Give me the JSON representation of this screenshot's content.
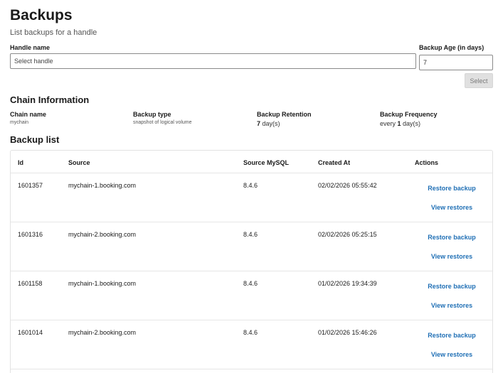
{
  "header": {
    "title": "Backups",
    "subtitle": "List backups for a handle"
  },
  "form": {
    "handle_label": "Handle name",
    "handle_placeholder": "Select handle",
    "age_label": "Backup Age (in days)",
    "age_value": "7",
    "select_label": "Select"
  },
  "chain": {
    "section_title": "Chain Information",
    "name_label": "Chain name",
    "name_value": "mychain",
    "type_label": "Backup type",
    "type_value": "snapshot of logical volume",
    "retention_label": "Backup Retention",
    "retention_num": "7",
    "retention_unit": " day(s)",
    "frequency_label": "Backup Frequency",
    "frequency_prefix": "every ",
    "frequency_num": "1",
    "frequency_unit": " day(s)"
  },
  "backup_list": {
    "section_title": "Backup list",
    "columns": [
      "Id",
      "Source",
      "Source MySQL",
      "Created At",
      "Actions"
    ],
    "restore_label": "Restore backup",
    "view_label": "View restores",
    "rows": [
      {
        "id": "1601357",
        "source": "mychain-1.booking.com",
        "mysql": "8.4.6",
        "created": "02/02/2026 05:55:42"
      },
      {
        "id": "1601316",
        "source": "mychain-2.booking.com",
        "mysql": "8.4.6",
        "created": "02/02/2026 05:25:15"
      },
      {
        "id": "1601158",
        "source": "mychain-1.booking.com",
        "mysql": "8.4.6",
        "created": "01/02/2026 19:34:39"
      },
      {
        "id": "1601014",
        "source": "mychain-2.booking.com",
        "mysql": "8.4.6",
        "created": "01/02/2026 15:46:26"
      }
    ]
  },
  "colors": {
    "link": "#1f6fb5",
    "button_disabled_bg": "#e0e0e0",
    "border": "#e2e2e2"
  }
}
